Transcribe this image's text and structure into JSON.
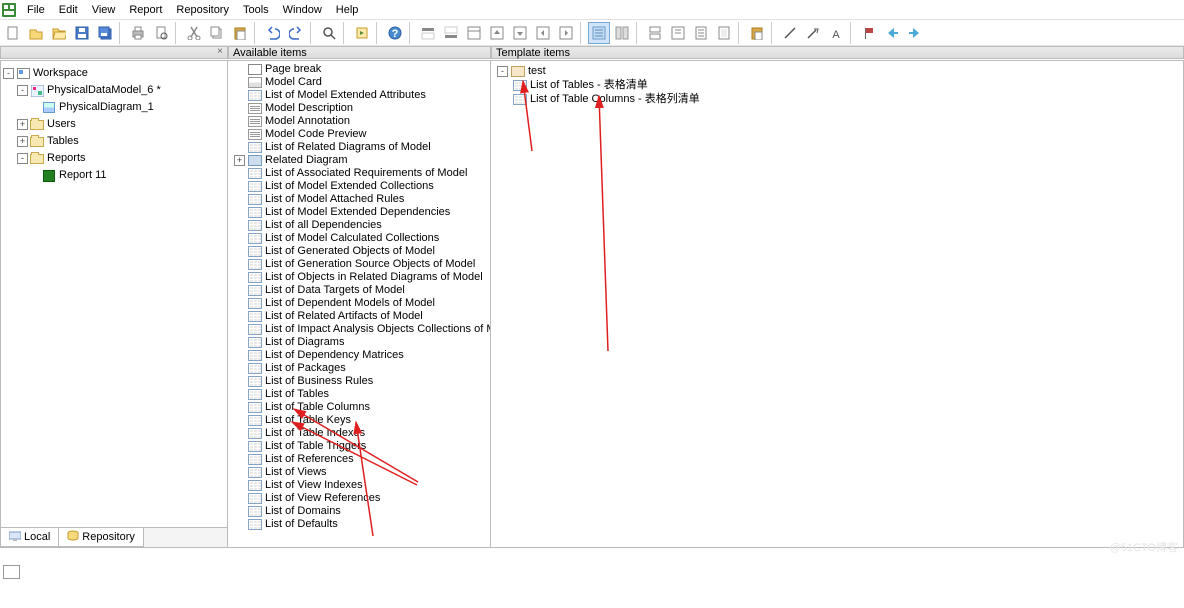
{
  "menu": {
    "items": [
      "File",
      "Edit",
      "View",
      "Report",
      "Repository",
      "Tools",
      "Window",
      "Help"
    ]
  },
  "panels": {
    "workspace_close": "×",
    "center_title": "Available items",
    "right_title": "Template items"
  },
  "workspace": {
    "root": "Workspace",
    "nodes": [
      {
        "label": "PhysicalDataModel_6 *",
        "exp": "-",
        "indent": 1,
        "type": "model"
      },
      {
        "label": "PhysicalDiagram_1",
        "exp": "",
        "indent": 2,
        "type": "diagram"
      },
      {
        "label": "Users",
        "exp": "+",
        "indent": 1,
        "type": "folder"
      },
      {
        "label": "Tables",
        "exp": "+",
        "indent": 1,
        "type": "folder"
      },
      {
        "label": "Reports",
        "exp": "-",
        "indent": 1,
        "type": "folder"
      },
      {
        "label": "Report 11",
        "exp": "",
        "indent": 2,
        "type": "report"
      }
    ]
  },
  "left_tabs": {
    "local": "Local",
    "repository": "Repository"
  },
  "available_items": [
    {
      "label": "Page break",
      "ic": "page"
    },
    {
      "label": "Model Card",
      "ic": "card"
    },
    {
      "label": "List of Model Extended Attributes",
      "ic": "grid"
    },
    {
      "label": "Model Description",
      "ic": "desc"
    },
    {
      "label": "Model Annotation",
      "ic": "desc"
    },
    {
      "label": "Model Code Preview",
      "ic": "desc"
    },
    {
      "label": "List of Related Diagrams of Model",
      "ic": "grid"
    },
    {
      "label": "Related Diagram",
      "ic": "diag",
      "exp": "+",
      "has_exp": true
    },
    {
      "label": "List of Associated Requirements of Model",
      "ic": "grid"
    },
    {
      "label": "List of Model Extended Collections",
      "ic": "grid"
    },
    {
      "label": "List of Model Attached Rules",
      "ic": "grid"
    },
    {
      "label": "List of Model Extended Dependencies",
      "ic": "grid"
    },
    {
      "label": "List of all Dependencies",
      "ic": "grid"
    },
    {
      "label": "List of Model Calculated Collections",
      "ic": "grid"
    },
    {
      "label": "List of Generated Objects of Model",
      "ic": "grid"
    },
    {
      "label": "List of Generation Source Objects of Model",
      "ic": "grid"
    },
    {
      "label": "List of Objects in Related Diagrams of Model",
      "ic": "grid"
    },
    {
      "label": "List of Data Targets of Model",
      "ic": "grid"
    },
    {
      "label": "List of Dependent Models of Model",
      "ic": "grid"
    },
    {
      "label": "List of Related Artifacts of Model",
      "ic": "grid"
    },
    {
      "label": "List of Impact Analysis Objects Collections of Model",
      "ic": "grid"
    },
    {
      "label": "List of Diagrams",
      "ic": "grid"
    },
    {
      "label": "List of Dependency Matrices",
      "ic": "grid"
    },
    {
      "label": "List of Packages",
      "ic": "grid"
    },
    {
      "label": "List of Business Rules",
      "ic": "grid"
    },
    {
      "label": "List of Tables",
      "ic": "grid"
    },
    {
      "label": "List of Table Columns",
      "ic": "grid"
    },
    {
      "label": "List of Table Keys",
      "ic": "grid"
    },
    {
      "label": "List of Table Indexes",
      "ic": "grid"
    },
    {
      "label": "List of Table Triggers",
      "ic": "grid"
    },
    {
      "label": "List of References",
      "ic": "grid"
    },
    {
      "label": "List of Views",
      "ic": "grid"
    },
    {
      "label": "List of View Indexes",
      "ic": "grid"
    },
    {
      "label": "List of View References",
      "ic": "grid"
    },
    {
      "label": "List of Domains",
      "ic": "grid"
    },
    {
      "label": "List of Defaults",
      "ic": "grid"
    }
  ],
  "template_items": {
    "root": "test",
    "children": [
      {
        "label": "List of Tables - 表格清单",
        "ic": "grid"
      },
      {
        "label": "List of Table Columns - 表格列清单",
        "ic": "grid"
      }
    ]
  },
  "watermark": "@51CTO博客"
}
